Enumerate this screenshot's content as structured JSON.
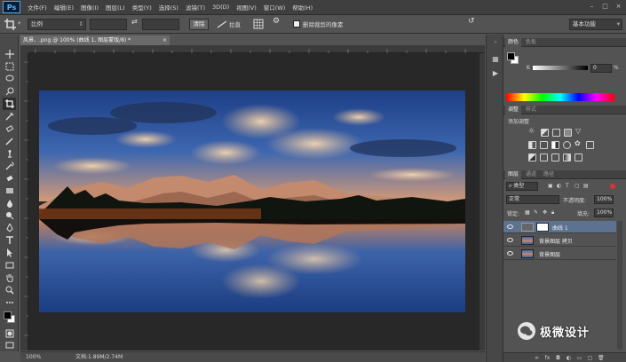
{
  "app": {
    "logo": "Ps"
  },
  "menu": [
    "文件(F)",
    "编辑(E)",
    "图像(I)",
    "图层(L)",
    "类型(Y)",
    "选择(S)",
    "滤镜(T)",
    "3D(D)",
    "视图(V)",
    "窗口(W)",
    "帮助(H)"
  ],
  "window_controls": [
    "–",
    "□",
    "×"
  ],
  "options": {
    "ratio": "比例",
    "swap_icon": "⇄",
    "clear": "清除",
    "straighten": "拉直",
    "delete_cropped": "删除裁剪的像素",
    "workspace": "基本功能"
  },
  "document": {
    "tab_title": "风景、.png @ 100% (曲线 1, 图层蒙版/8) *",
    "zoom": "100%",
    "doc_size": "文档:1.89M/2.74M"
  },
  "panels": {
    "color": {
      "tabs": [
        "颜色",
        "色板"
      ],
      "channel": "K",
      "value": "0",
      "unit": "%"
    },
    "adjustments": {
      "tabs": [
        "调整",
        "样式"
      ],
      "title": "添加调整"
    },
    "layers": {
      "tabs": [
        "图层",
        "通道",
        "路径"
      ],
      "filter": "类型",
      "blend_mode": "正常",
      "opacity_label": "不透明度:",
      "opacity": "100%",
      "lock_label": "锁定:",
      "fill_label": "填充:",
      "fill": "100%",
      "items": [
        {
          "name": "曲线 1",
          "selected": true
        },
        {
          "name": "背景图层 拷贝",
          "selected": false
        },
        {
          "name": "背景图层",
          "selected": false
        }
      ],
      "footer_icons": [
        "∞",
        "fx",
        "◘",
        "◐",
        "▭",
        "▢",
        "🗑"
      ]
    }
  },
  "watermark": "极微设计",
  "colors": {
    "accent_selected_layer": "#5d7290",
    "ps_blue": "#58b7f2"
  }
}
